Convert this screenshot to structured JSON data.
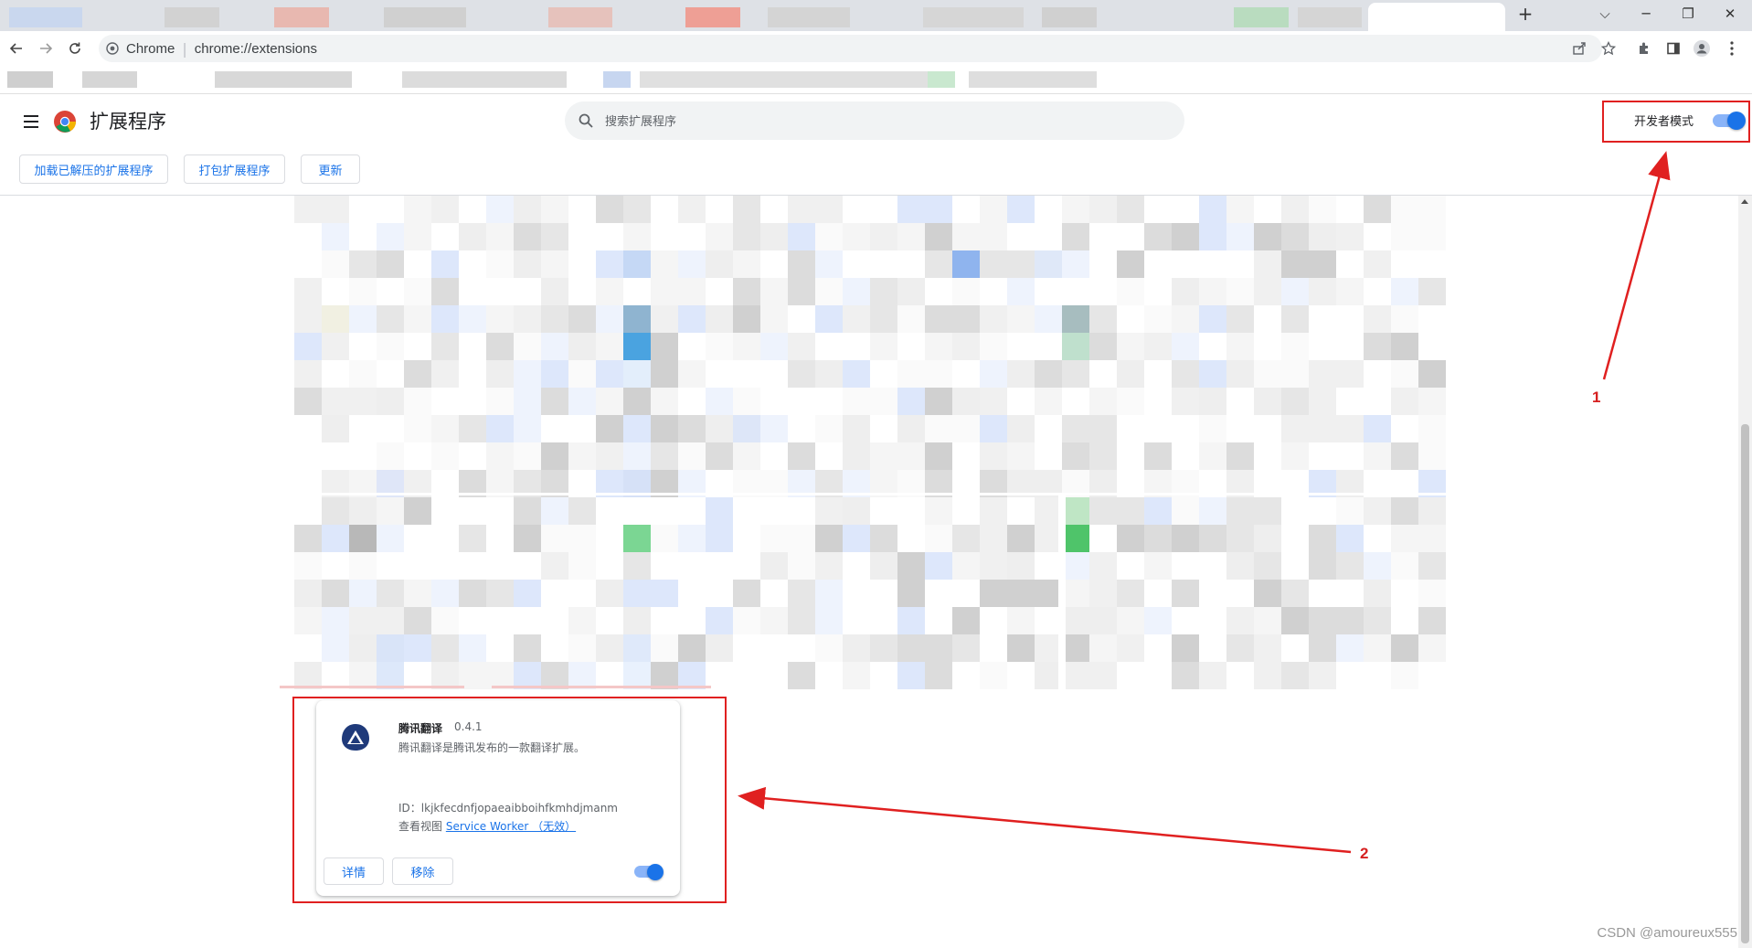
{
  "window": {
    "new_tab_symbol": "+",
    "tab_search_symbol": "⌵",
    "minimize_symbol": "─",
    "restore_symbol": "❐",
    "close_symbol": "✕"
  },
  "address_bar": {
    "site_chip": "Chrome",
    "url": "chrome://extensions"
  },
  "extensions_page": {
    "title": "扩展程序",
    "search_placeholder": "搜索扩展程序",
    "developer_mode_label": "开发者模式",
    "developer_mode_on": true,
    "buttons": {
      "load_unpacked": "加载已解压的扩展程序",
      "pack": "打包扩展程序",
      "update": "更新"
    }
  },
  "extension_card": {
    "name": "腾讯翻译",
    "version": "0.4.1",
    "description": "腾讯翻译是腾讯发布的一款翻译扩展。",
    "id_text": "ID：lkjkfecdnfjopaeaibboihfkmhdjmanm",
    "views_label": "查看视图",
    "views_link": "Service Worker （无效）",
    "details_button": "详情",
    "remove_button": "移除",
    "enabled": true
  },
  "annotations": {
    "label_1": "1",
    "label_2": "2",
    "color": "#e02020"
  },
  "watermark": "CSDN @amoureux555",
  "colors": {
    "accent": "#1a73e8",
    "toggle_track": "#8ab4f8",
    "annotation_red": "#e02020"
  }
}
